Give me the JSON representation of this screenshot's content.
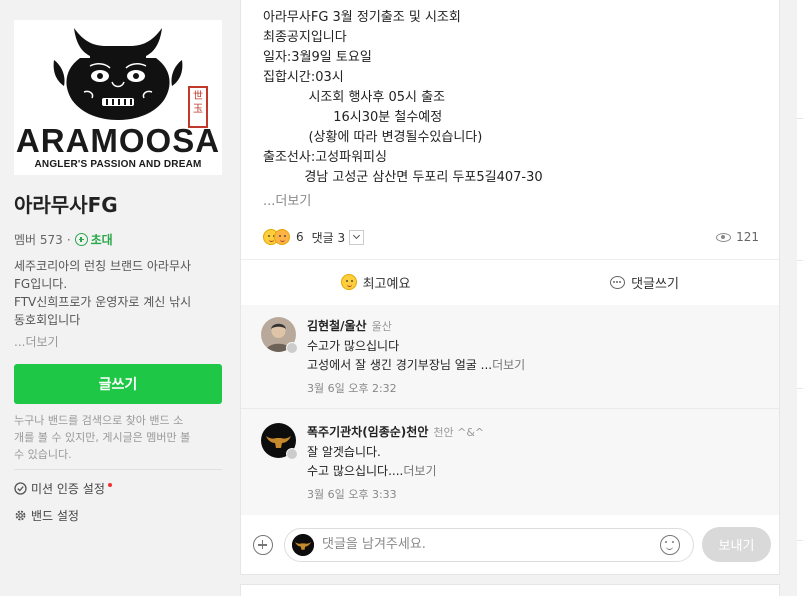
{
  "band": {
    "logo_text": "ARAMOOSA",
    "logo_tagline": "ANGLER'S PASSION AND DREAM",
    "logo_seal": "世玉",
    "name": "아라무사FG",
    "members_label": "멤버 573",
    "invite_label": "초대",
    "description": [
      "세주코리아의 런칭 브랜드 아라무사",
      "FG입니다.",
      "FTV신희프로가 운영자로 계신 낚시",
      "동호회입니다"
    ],
    "description_more": "...더보기",
    "write_button": "글쓰기",
    "notice": [
      "누구나 밴드를 검색으로 찾아 밴드 소",
      "개를 볼 수 있지만, 게시글은 멤버만 볼",
      "수 있습니다."
    ],
    "menu": {
      "mission": "미션 인증 설정",
      "settings": "밴드 설정"
    }
  },
  "post": {
    "lines": [
      "아라무사FG 3월 정기출조 및 시조회",
      "최종공지입니다",
      "일자:3월9일 토요일",
      "집합시간:03시",
      "           시조회 행사후 05시 출조",
      "                 16시30분 철수예정",
      "           (상황에 따라 변경될수있습니다)",
      "출조선사:고성파워피싱",
      "          경남 고성군 삼산면 두포리 두포5길407-30"
    ],
    "more": "...더보기",
    "emotion_count": "6",
    "comment_label": "댓글 3",
    "views": "121",
    "actions": {
      "react": "최고예요",
      "comment": "댓글쓰기"
    }
  },
  "comments": [
    {
      "author": "김현철/울산",
      "meta": "울산",
      "lines": [
        "수고가 많으십니다",
        "고성에서 잘 생긴 경기부장님 얼굴 ..."
      ],
      "more": "더보기",
      "date": "3월 6일 오후 2:32"
    },
    {
      "author": "폭주기관차(임종순)천안",
      "meta": "천안 ^&^",
      "lines": [
        "잘 알겟습니다.",
        "수고 많으십니다...."
      ],
      "more": "더보기",
      "date": "3월 6일 오후 3:33"
    }
  ],
  "comment_input": {
    "placeholder": "댓글을 남겨주세요.",
    "send": "보내기"
  }
}
